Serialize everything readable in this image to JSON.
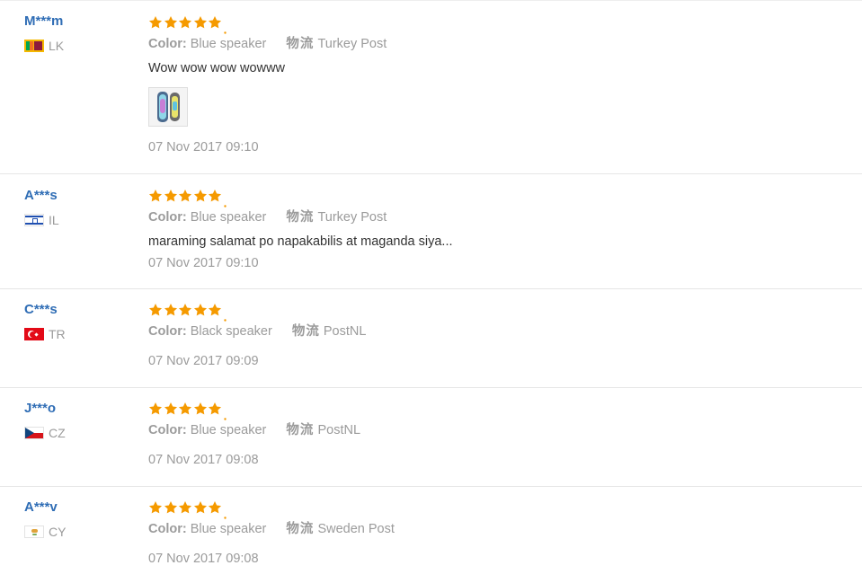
{
  "labels": {
    "color": "Color:",
    "logistics": "物流"
  },
  "colors": {
    "star": "#f59a00",
    "username": "#2f6db5"
  },
  "reviews": [
    {
      "user": "M***m",
      "country": "LK",
      "flag_icon": "flag-lk-icon",
      "rating": 5,
      "color_value": "Blue speaker",
      "logistics_value": "Turkey Post",
      "text": "Wow wow wow wowww",
      "has_photo": true,
      "photo_icon": "speaker-photo",
      "date": "07 Nov 2017 09:10"
    },
    {
      "user": "A***s",
      "country": "IL",
      "flag_icon": "flag-il-icon",
      "rating": 5,
      "color_value": "Blue speaker",
      "logistics_value": "Turkey Post",
      "text": "maraming salamat po napakabilis at maganda siya...",
      "has_photo": false,
      "date": "07 Nov 2017 09:10"
    },
    {
      "user": "C***s",
      "country": "TR",
      "flag_icon": "flag-tr-icon",
      "rating": 5,
      "color_value": "Black speaker",
      "logistics_value": "PostNL",
      "text": "",
      "has_photo": false,
      "date": "07 Nov 2017 09:09"
    },
    {
      "user": "J***o",
      "country": "CZ",
      "flag_icon": "flag-cz-icon",
      "rating": 5,
      "color_value": "Blue speaker",
      "logistics_value": "PostNL",
      "text": "",
      "has_photo": false,
      "date": "07 Nov 2017 09:08"
    },
    {
      "user": "A***v",
      "country": "CY",
      "flag_icon": "flag-cy-icon",
      "rating": 5,
      "color_value": "Blue speaker",
      "logistics_value": "Sweden Post",
      "text": "",
      "has_photo": false,
      "date": "07 Nov 2017 09:08"
    }
  ]
}
